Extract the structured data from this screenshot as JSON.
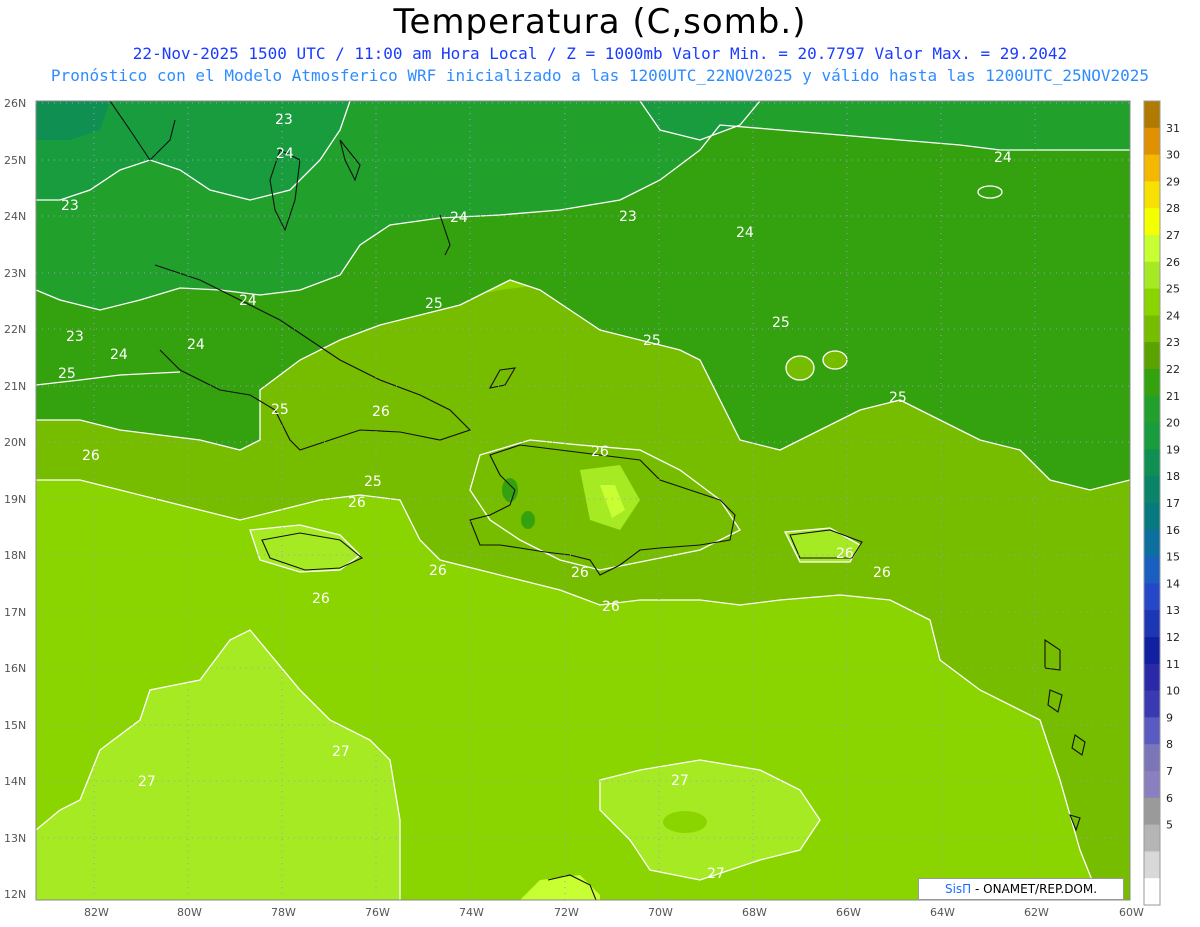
{
  "header": {
    "title": "Temperatura (C,somb.)",
    "subtitle_line1": "22-Nov-2025 1500 UTC / 11:00 am Hora Local / Z = 1000mb  Valor Min. = 20.7797  Valor Max. = 29.2042",
    "subtitle_line2": "Pronóstico con el Modelo Atmosferico WRF inicializado a las 1200UTC_22NOV2025 y válido hasta las  1200UTC_25NOV2025"
  },
  "axes": {
    "lat_labels": [
      "26N",
      "25N",
      "24N",
      "23N",
      "22N",
      "21N",
      "20N",
      "19N",
      "18N",
      "17N",
      "16N",
      "15N",
      "14N",
      "13N",
      "12N"
    ],
    "lon_labels": [
      "82W",
      "80W",
      "78W",
      "76W",
      "74W",
      "72W",
      "70W",
      "68W",
      "66W",
      "64W",
      "62W",
      "60W"
    ]
  },
  "contour_labels": {
    "c23a": "23",
    "c23b": "23",
    "c23c": "23",
    "c23d": "23",
    "c24a": "24",
    "c24b": "24",
    "c24c": "24",
    "c24d": "24",
    "c24e": "24",
    "c24f": "24",
    "c24g": "24",
    "c25a": "25",
    "c25b": "25",
    "c25c": "25",
    "c25d": "25",
    "c25e": "25",
    "c25f": "25",
    "c25g": "25",
    "c26a": "26",
    "c26b": "26",
    "c26c": "26",
    "c26d": "26",
    "c26e": "26",
    "c26f": "26",
    "c26g": "26",
    "c26h": "26",
    "c26i": "26",
    "c27a": "27",
    "c27b": "27",
    "c27c": "27",
    "c27d": "27"
  },
  "colorbar": {
    "labels": [
      "31",
      "30",
      "29",
      "28",
      "27",
      "26",
      "25",
      "24",
      "23",
      "22",
      "21",
      "20",
      "19",
      "18",
      "17",
      "16",
      "15",
      "14",
      "13",
      "12",
      "11",
      "10",
      "9",
      "8",
      "7",
      "6",
      "5"
    ],
    "colors": [
      "#b07a00",
      "#e09000",
      "#f5b800",
      "#f8e000",
      "#f4ff00",
      "#c8ff33",
      "#a5ea22",
      "#8ad400",
      "#76bd00",
      "#5aa300",
      "#34a10f",
      "#22a02c",
      "#189c3e",
      "#0f9052",
      "#0a8468",
      "#067a80",
      "#0d6ea0",
      "#1a5ec0",
      "#2448c8",
      "#1c36b4",
      "#1020a0",
      "#2a2aa8",
      "#3a3ab0",
      "#5a5ac0",
      "#7a76b8",
      "#8a80c0",
      "#9a9a9a",
      "#b5b5b5",
      "#d8d8d8",
      "#ffffff"
    ]
  },
  "credit": {
    "brand": "SisΠ",
    "text": " - ONAMET/REP.DOM."
  }
}
